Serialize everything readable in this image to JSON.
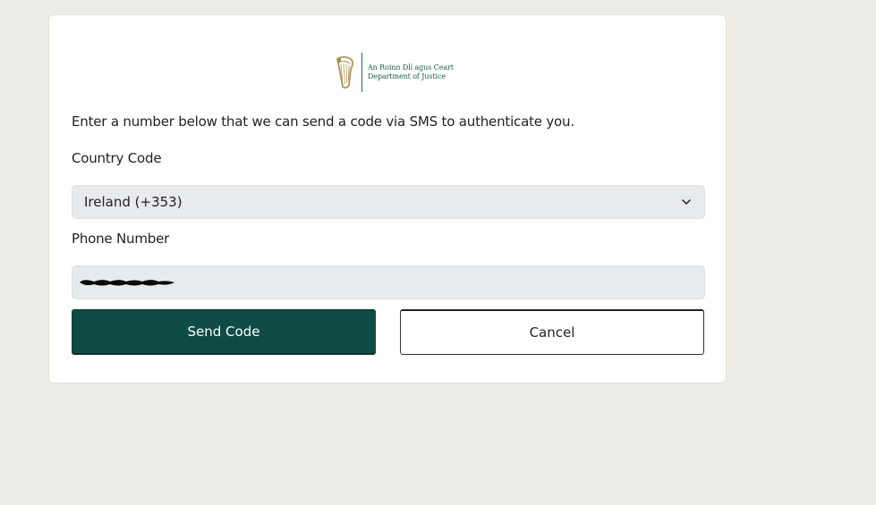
{
  "logo": {
    "line1": "An Roinn Dlí agus Ceart",
    "line2": "Department of Justice"
  },
  "intro": "Enter a number below that we can send a code via SMS to authenticate you.",
  "country": {
    "label": "Country Code",
    "selected": "Ireland (+353)",
    "icon": "chevron-down-icon"
  },
  "phone": {
    "label": "Phone Number",
    "value": ""
  },
  "buttons": {
    "send": "Send Code",
    "cancel": "Cancel"
  },
  "colors": {
    "page_bg": "#eeede7",
    "primary": "#0e4b43",
    "field_bg": "#e8ebed",
    "brand_text": "#1d5d4f"
  }
}
